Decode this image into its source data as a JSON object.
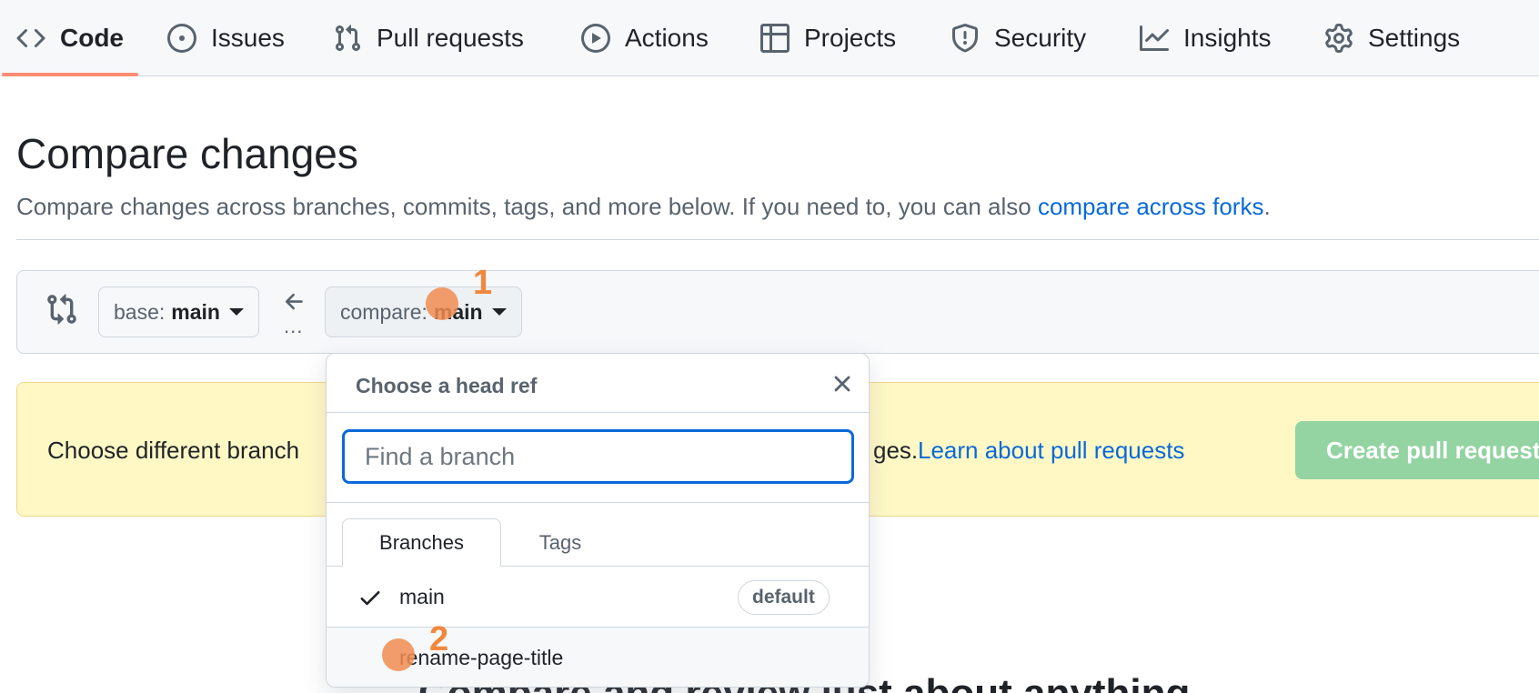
{
  "nav": {
    "tabs": [
      {
        "label": "Code",
        "icon": "code-icon"
      },
      {
        "label": "Issues",
        "icon": "issue-icon"
      },
      {
        "label": "Pull requests",
        "icon": "pull-request-icon"
      },
      {
        "label": "Actions",
        "icon": "play-icon"
      },
      {
        "label": "Projects",
        "icon": "table-icon"
      },
      {
        "label": "Security",
        "icon": "shield-icon"
      },
      {
        "label": "Insights",
        "icon": "graph-icon"
      },
      {
        "label": "Settings",
        "icon": "gear-icon"
      }
    ],
    "active_tab": "Code",
    "underline_color": "#fd8c73"
  },
  "header": {
    "title": "Compare changes",
    "subtitle": "Compare changes across branches, commits, tags, and more below. If you need to, you can also ",
    "subtitle_link": "compare across forks",
    "subtitle_end": "."
  },
  "range": {
    "base_prefix": "base:",
    "base_branch": "main",
    "compare_prefix": "compare:",
    "compare_branch": "main",
    "dots": "..."
  },
  "flash": {
    "text_left": "Choose different branch",
    "text_right": "ges.",
    "link": "Learn about pull requests",
    "button": "Create pull request",
    "bg_color": "#fff8c5"
  },
  "bottom": {
    "heading": "Compare and review just about anything"
  },
  "dropdown": {
    "title": "Choose a head ref",
    "search_placeholder": "Find a branch",
    "tabs": [
      "Branches",
      "Tags"
    ],
    "branches": [
      {
        "name": "main",
        "selected": true,
        "badge": "default"
      },
      {
        "name": "rename-page-title",
        "selected": false
      }
    ]
  },
  "annotations": [
    {
      "number": "1"
    },
    {
      "number": "2"
    }
  ],
  "colors": {
    "link": "#0969da",
    "create_button": "#94d3a2",
    "marker": "#f0883e"
  }
}
